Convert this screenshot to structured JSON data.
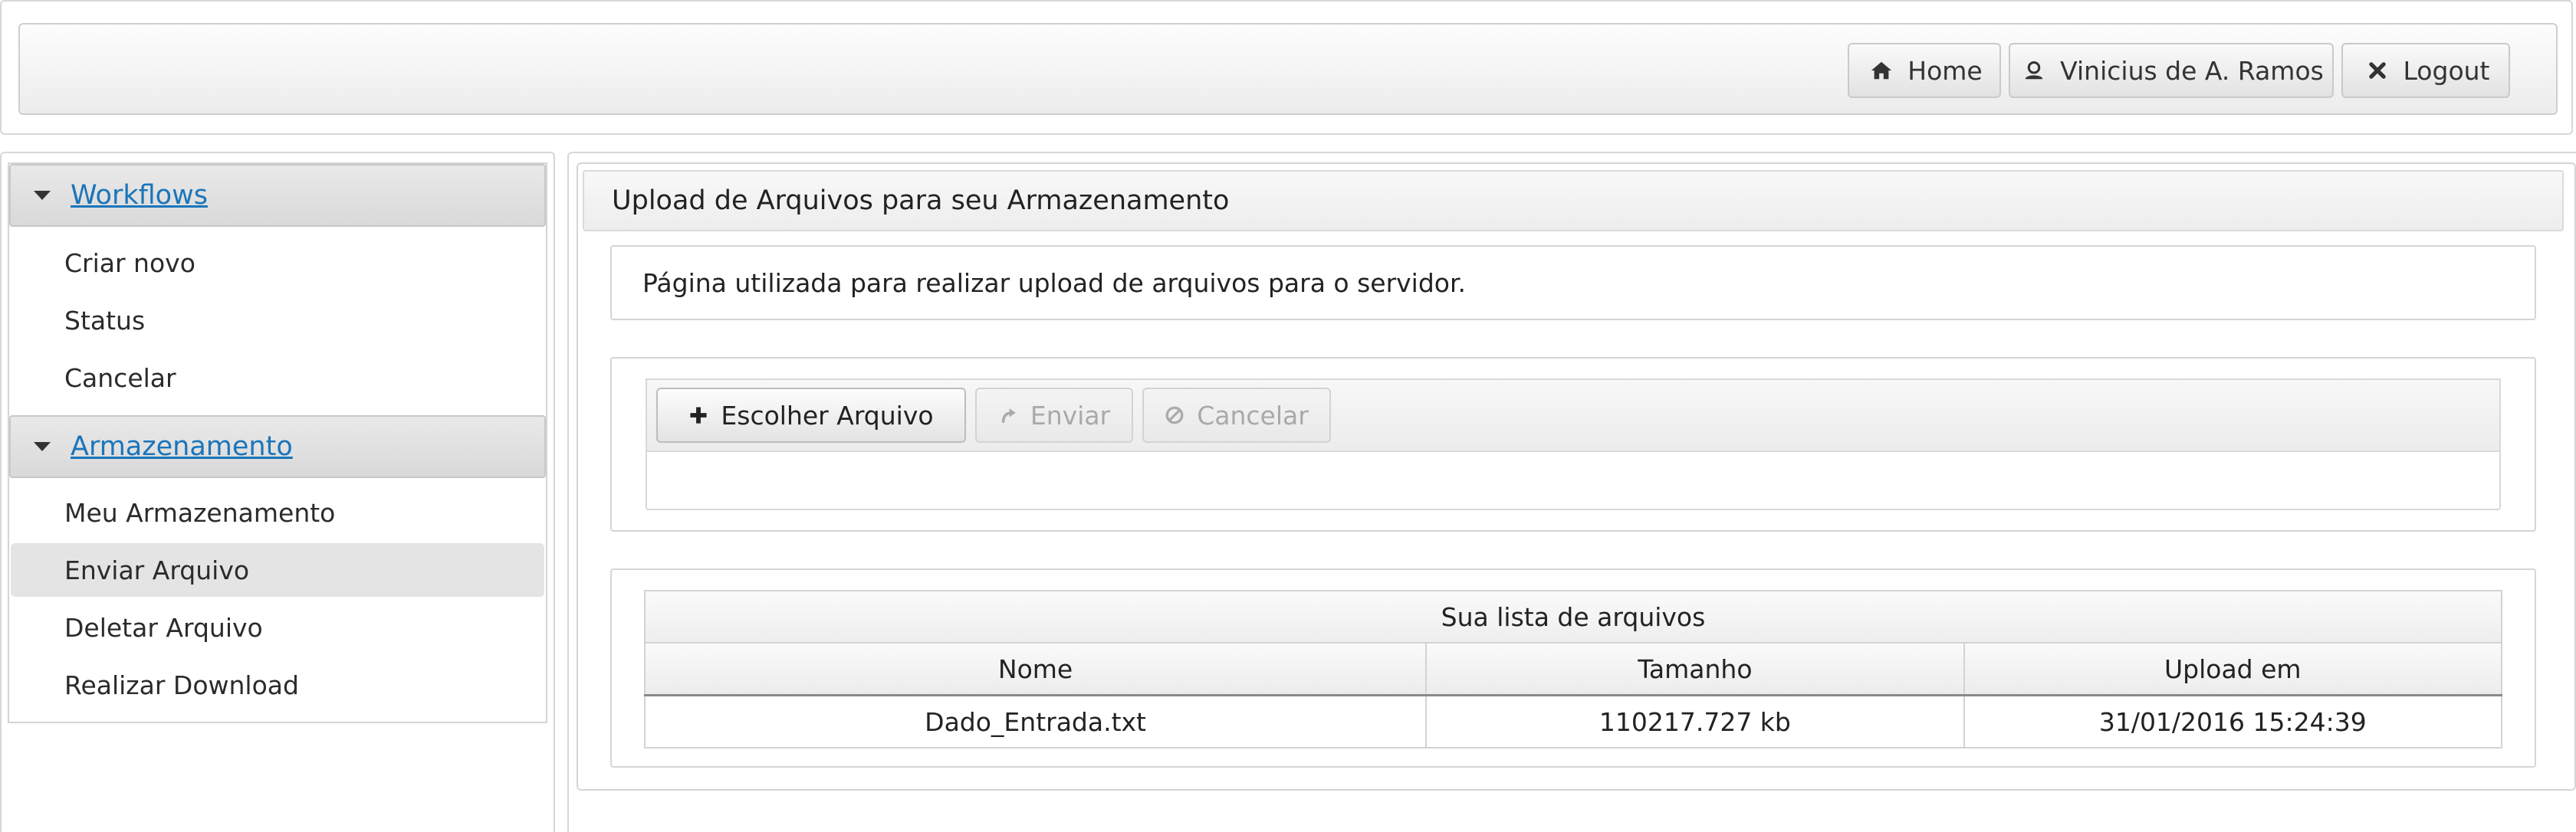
{
  "header": {
    "buttons": [
      {
        "label": "Home",
        "icon": "home-icon"
      },
      {
        "label": "Vinicius de A. Ramos",
        "icon": "user-icon"
      },
      {
        "label": "Logout",
        "icon": "close-icon"
      }
    ]
  },
  "sidebar": {
    "sections": [
      {
        "title": "Workflows",
        "items": [
          {
            "label": "Criar novo"
          },
          {
            "label": "Status"
          },
          {
            "label": "Cancelar"
          }
        ]
      },
      {
        "title": "Armazenamento",
        "items": [
          {
            "label": "Meu Armazenamento"
          },
          {
            "label": "Enviar Arquivo",
            "active": true
          },
          {
            "label": "Deletar Arquivo"
          },
          {
            "label": "Realizar Download"
          }
        ]
      }
    ]
  },
  "main": {
    "title": "Upload de Arquivos para seu Armazenamento",
    "description": "Página utilizada para realizar upload de arquivos para o servidor.",
    "upload": {
      "choose_label": "Escolher Arquivo",
      "send_label": "Enviar",
      "cancel_label": "Cancelar"
    },
    "files": {
      "caption": "Sua lista de arquivos",
      "columns": [
        "Nome",
        "Tamanho",
        "Upload em"
      ],
      "rows": [
        [
          "Dado_Entrada.txt",
          "110217.727 kb",
          "31/01/2016 15:24:39"
        ]
      ]
    }
  },
  "colors": {
    "link": "#1a75bb",
    "disabled_text": "#a9a9a9"
  }
}
